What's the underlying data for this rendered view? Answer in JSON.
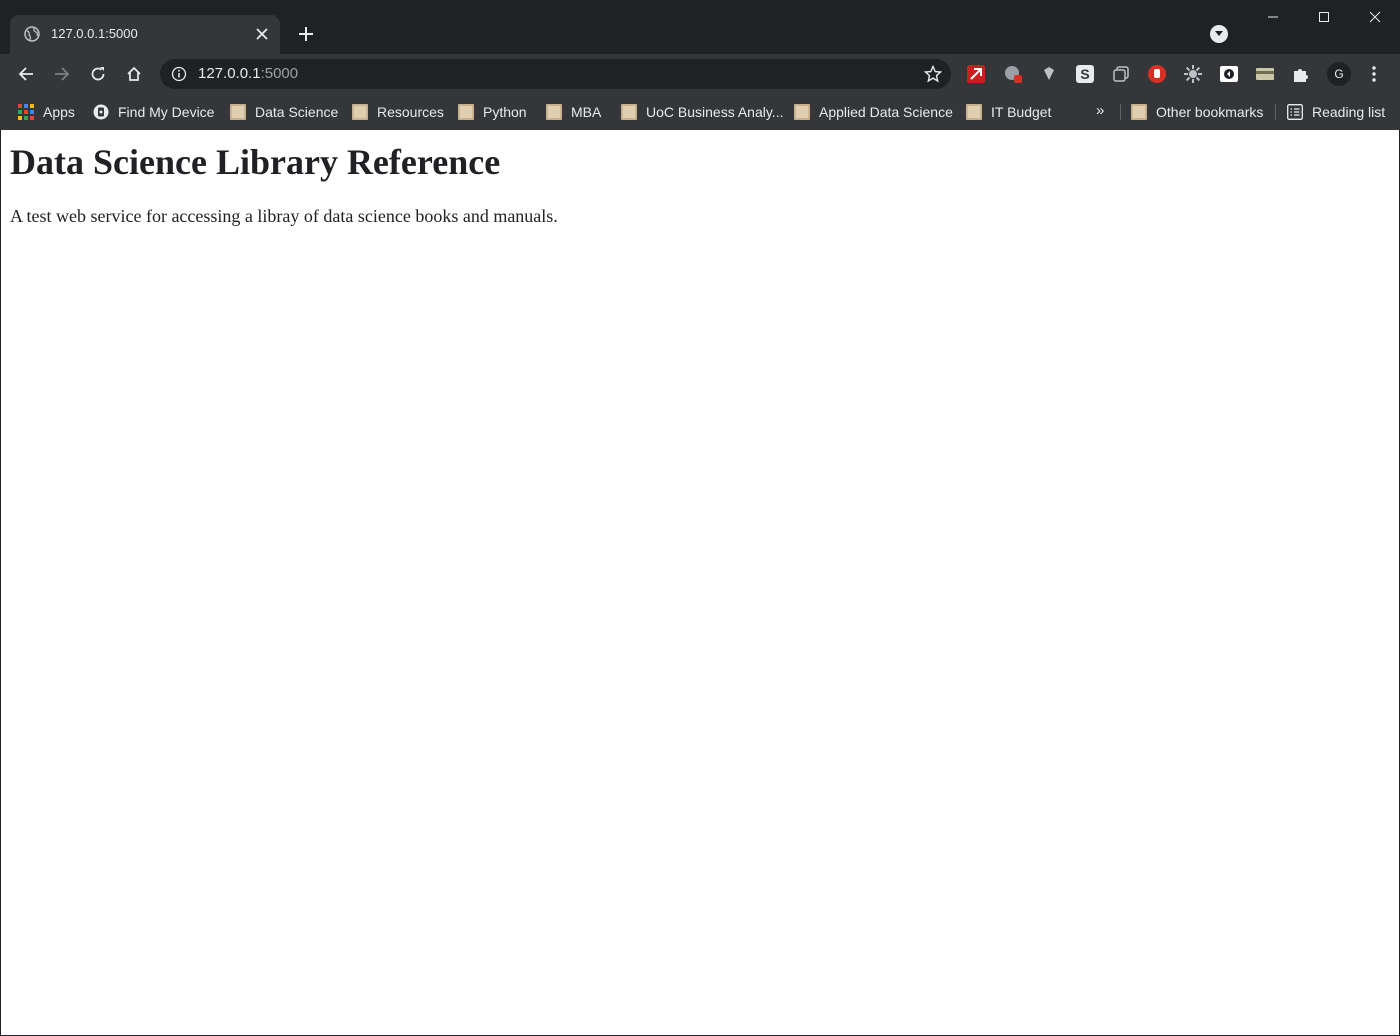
{
  "browser": {
    "tab": {
      "title": "127.0.0.1:5000"
    },
    "address_bar": {
      "host": "127.0.0.1",
      "port": ":5000"
    },
    "profile_initial": "G",
    "accent_color": "#35363a",
    "frame_color": "#202124"
  },
  "bookmarks": {
    "items": [
      {
        "label": "Apps",
        "icon": "apps-grid-icon"
      },
      {
        "label": "Find My Device",
        "icon": "find-my-device-icon"
      },
      {
        "label": "Data Science",
        "icon": "folder-icon"
      },
      {
        "label": "Resources",
        "icon": "folder-icon"
      },
      {
        "label": "Python",
        "icon": "folder-icon"
      },
      {
        "label": "MBA",
        "icon": "folder-icon"
      },
      {
        "label": "UoC Business Analy...",
        "icon": "folder-icon"
      },
      {
        "label": "Applied Data Science",
        "icon": "folder-icon"
      },
      {
        "label": "IT Budget",
        "icon": "folder-icon"
      }
    ],
    "overflow": "»",
    "other": "Other bookmarks",
    "reading_list": "Reading list"
  },
  "page": {
    "title": "Data Science Library Reference",
    "description": "A test web service for accessing a libray of data science books and manuals."
  }
}
